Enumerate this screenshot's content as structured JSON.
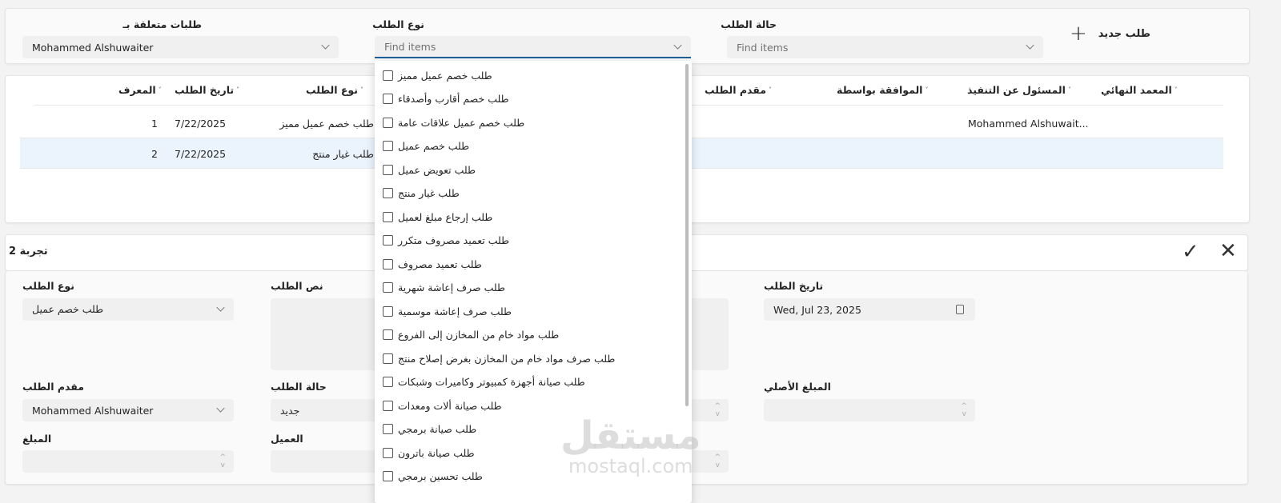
{
  "filters": {
    "related_label": "طلبات متعلقة بـ",
    "related_value": "Mohammed Alshuwaiter",
    "type_label": "نوع الطلب",
    "type_placeholder": "Find items",
    "status_label": "حالة الطلب",
    "status_placeholder": "Find items",
    "new_request": "طلب جديد"
  },
  "grid": {
    "columns": [
      "المعرف",
      "تاريخ الطلب",
      "نوع الطلب",
      "مقدم الطلب",
      "الموافقة بواسطة",
      "المسئول عن التنفيذ",
      "المعمد النهائي"
    ],
    "rows": [
      {
        "id": "1",
        "date": "7/22/2025",
        "type": "طلب خصم عميل مميز",
        "responsible": "Mohammed Alshuwait..."
      },
      {
        "id": "2",
        "date": "7/22/2025",
        "type": "طلب غيار منتج",
        "responsible": ""
      }
    ]
  },
  "dropdown": {
    "options": [
      "طلب خصم عميل مميز",
      "طلب خصم أقارب وأصدقاء",
      "طلب خصم عميل علاقات عامة",
      "طلب خصم عميل",
      "طلب تعويض عميل",
      "طلب غيار منتج",
      "طلب إرجاع مبلغ لعميل",
      "طلب تعميد مصروف متكرر",
      "طلب تعميد مصروف",
      "طلب صرف إعاشة شهرية",
      "طلب صرف إعاشة موسمية",
      "طلب مواد خام من المخازن إلى الفروع",
      "طلب صرف مواد خام من المخازن بغرض إصلاح منتج",
      "طلب صيانة أجهزة كمبيوتر وكاميرات وشبكات",
      "طلب صيانة ألات ومعدات",
      "طلب صيانة برمجي",
      "طلب صيانة باترون",
      "طلب تحسين برمجي"
    ]
  },
  "form": {
    "title": "تجربة 2",
    "type_label": "نوع الطلب",
    "type_value": "طلب خصم عميل",
    "text_label": "نص الطلب",
    "date_label": "تاريخ الطلب",
    "date_value": "Wed, Jul 23, 2025",
    "requester_label": "مقدم الطلب",
    "requester_value": "Mohammed Alshuwaiter",
    "status_label": "حالة الطلب",
    "status_value": "جديد",
    "original_amount_label": "المبلغ الأصلي",
    "amount_label": "المبلغ",
    "customer_label": "العميل"
  },
  "watermark": {
    "arabic": "مستقل",
    "latin": "mostaql.com"
  }
}
